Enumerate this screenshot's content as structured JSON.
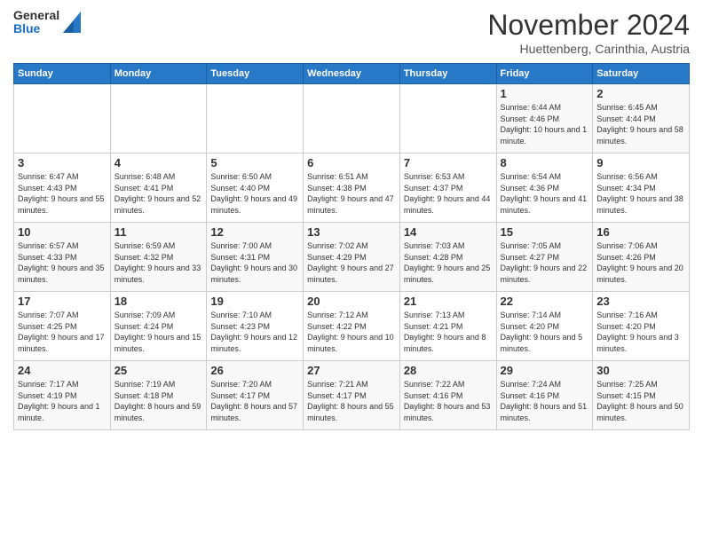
{
  "logo": {
    "general": "General",
    "blue": "Blue"
  },
  "title": "November 2024",
  "subtitle": "Huettenberg, Carinthia, Austria",
  "days_of_week": [
    "Sunday",
    "Monday",
    "Tuesday",
    "Wednesday",
    "Thursday",
    "Friday",
    "Saturday"
  ],
  "weeks": [
    [
      {
        "day": "",
        "info": ""
      },
      {
        "day": "",
        "info": ""
      },
      {
        "day": "",
        "info": ""
      },
      {
        "day": "",
        "info": ""
      },
      {
        "day": "",
        "info": ""
      },
      {
        "day": "1",
        "info": "Sunrise: 6:44 AM\nSunset: 4:46 PM\nDaylight: 10 hours and 1 minute."
      },
      {
        "day": "2",
        "info": "Sunrise: 6:45 AM\nSunset: 4:44 PM\nDaylight: 9 hours and 58 minutes."
      }
    ],
    [
      {
        "day": "3",
        "info": "Sunrise: 6:47 AM\nSunset: 4:43 PM\nDaylight: 9 hours and 55 minutes."
      },
      {
        "day": "4",
        "info": "Sunrise: 6:48 AM\nSunset: 4:41 PM\nDaylight: 9 hours and 52 minutes."
      },
      {
        "day": "5",
        "info": "Sunrise: 6:50 AM\nSunset: 4:40 PM\nDaylight: 9 hours and 49 minutes."
      },
      {
        "day": "6",
        "info": "Sunrise: 6:51 AM\nSunset: 4:38 PM\nDaylight: 9 hours and 47 minutes."
      },
      {
        "day": "7",
        "info": "Sunrise: 6:53 AM\nSunset: 4:37 PM\nDaylight: 9 hours and 44 minutes."
      },
      {
        "day": "8",
        "info": "Sunrise: 6:54 AM\nSunset: 4:36 PM\nDaylight: 9 hours and 41 minutes."
      },
      {
        "day": "9",
        "info": "Sunrise: 6:56 AM\nSunset: 4:34 PM\nDaylight: 9 hours and 38 minutes."
      }
    ],
    [
      {
        "day": "10",
        "info": "Sunrise: 6:57 AM\nSunset: 4:33 PM\nDaylight: 9 hours and 35 minutes."
      },
      {
        "day": "11",
        "info": "Sunrise: 6:59 AM\nSunset: 4:32 PM\nDaylight: 9 hours and 33 minutes."
      },
      {
        "day": "12",
        "info": "Sunrise: 7:00 AM\nSunset: 4:31 PM\nDaylight: 9 hours and 30 minutes."
      },
      {
        "day": "13",
        "info": "Sunrise: 7:02 AM\nSunset: 4:29 PM\nDaylight: 9 hours and 27 minutes."
      },
      {
        "day": "14",
        "info": "Sunrise: 7:03 AM\nSunset: 4:28 PM\nDaylight: 9 hours and 25 minutes."
      },
      {
        "day": "15",
        "info": "Sunrise: 7:05 AM\nSunset: 4:27 PM\nDaylight: 9 hours and 22 minutes."
      },
      {
        "day": "16",
        "info": "Sunrise: 7:06 AM\nSunset: 4:26 PM\nDaylight: 9 hours and 20 minutes."
      }
    ],
    [
      {
        "day": "17",
        "info": "Sunrise: 7:07 AM\nSunset: 4:25 PM\nDaylight: 9 hours and 17 minutes."
      },
      {
        "day": "18",
        "info": "Sunrise: 7:09 AM\nSunset: 4:24 PM\nDaylight: 9 hours and 15 minutes."
      },
      {
        "day": "19",
        "info": "Sunrise: 7:10 AM\nSunset: 4:23 PM\nDaylight: 9 hours and 12 minutes."
      },
      {
        "day": "20",
        "info": "Sunrise: 7:12 AM\nSunset: 4:22 PM\nDaylight: 9 hours and 10 minutes."
      },
      {
        "day": "21",
        "info": "Sunrise: 7:13 AM\nSunset: 4:21 PM\nDaylight: 9 hours and 8 minutes."
      },
      {
        "day": "22",
        "info": "Sunrise: 7:14 AM\nSunset: 4:20 PM\nDaylight: 9 hours and 5 minutes."
      },
      {
        "day": "23",
        "info": "Sunrise: 7:16 AM\nSunset: 4:20 PM\nDaylight: 9 hours and 3 minutes."
      }
    ],
    [
      {
        "day": "24",
        "info": "Sunrise: 7:17 AM\nSunset: 4:19 PM\nDaylight: 9 hours and 1 minute."
      },
      {
        "day": "25",
        "info": "Sunrise: 7:19 AM\nSunset: 4:18 PM\nDaylight: 8 hours and 59 minutes."
      },
      {
        "day": "26",
        "info": "Sunrise: 7:20 AM\nSunset: 4:17 PM\nDaylight: 8 hours and 57 minutes."
      },
      {
        "day": "27",
        "info": "Sunrise: 7:21 AM\nSunset: 4:17 PM\nDaylight: 8 hours and 55 minutes."
      },
      {
        "day": "28",
        "info": "Sunrise: 7:22 AM\nSunset: 4:16 PM\nDaylight: 8 hours and 53 minutes."
      },
      {
        "day": "29",
        "info": "Sunrise: 7:24 AM\nSunset: 4:16 PM\nDaylight: 8 hours and 51 minutes."
      },
      {
        "day": "30",
        "info": "Sunrise: 7:25 AM\nSunset: 4:15 PM\nDaylight: 8 hours and 50 minutes."
      }
    ]
  ]
}
